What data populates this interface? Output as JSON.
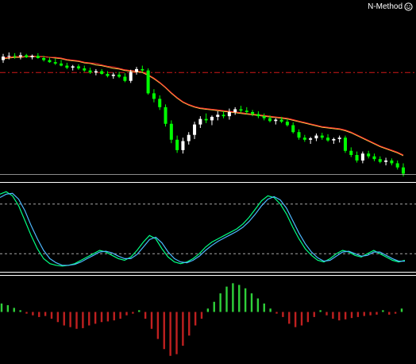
{
  "indicator_label": "N-Method",
  "icon": "smiley-icon",
  "colors": {
    "background": "#000000",
    "bull_candle": "#ffffff",
    "bear_candle": "#00ff00",
    "ma_fast": "#ffd24a",
    "ma_slow": "#ff2a2a",
    "level_line": "#d01818",
    "osc_fast": "#00ff80",
    "osc_slow": "#4db8ff",
    "hist_positive": "#2fd03a",
    "hist_negative": "#c02020",
    "separator": "#ffffff",
    "dashed_level": "#cfcfcf"
  },
  "chart_data": [
    {
      "type": "candlestick",
      "title": "",
      "series": [
        {
          "name": "",
          "kind": "ohlc",
          "values": [
            [
              100.4,
              101.3,
              100.0,
              100.9
            ],
            [
              100.9,
              101.5,
              100.5,
              101.0
            ],
            [
              101.0,
              101.4,
              100.6,
              100.9
            ],
            [
              100.9,
              101.5,
              100.5,
              101.1
            ],
            [
              101.1,
              101.3,
              100.7,
              100.8
            ],
            [
              100.8,
              101.2,
              100.5,
              101.0
            ],
            [
              101.0,
              101.4,
              100.6,
              100.7
            ],
            [
              100.7,
              101.0,
              100.2,
              100.4
            ],
            [
              100.4,
              100.8,
              100.0,
              100.1
            ],
            [
              100.1,
              100.6,
              99.7,
              99.9
            ],
            [
              99.9,
              100.4,
              99.5,
              99.6
            ],
            [
              99.6,
              100.0,
              99.1,
              99.3
            ],
            [
              99.3,
              99.7,
              98.9,
              99.5
            ],
            [
              99.5,
              99.8,
              99.0,
              99.2
            ],
            [
              99.2,
              99.6,
              98.7,
              98.9
            ],
            [
              98.9,
              99.3,
              98.4,
              98.6
            ],
            [
              98.6,
              99.1,
              98.2,
              98.8
            ],
            [
              98.8,
              99.1,
              98.3,
              98.4
            ],
            [
              98.4,
              98.8,
              97.9,
              98.1
            ],
            [
              98.1,
              98.6,
              97.7,
              98.3
            ],
            [
              98.3,
              98.7,
              97.8,
              98.0
            ],
            [
              98.0,
              98.5,
              97.2,
              97.4
            ],
            [
              97.4,
              99.0,
              97.1,
              98.7
            ],
            [
              98.7,
              99.4,
              98.3,
              99.1
            ],
            [
              99.1,
              99.6,
              98.6,
              98.9
            ],
            [
              98.9,
              99.2,
              95.4,
              95.6
            ],
            [
              95.6,
              96.2,
              94.3,
              94.8
            ],
            [
              94.8,
              95.3,
              93.2,
              93.6
            ],
            [
              93.6,
              94.0,
              90.8,
              91.2
            ],
            [
              91.2,
              91.7,
              88.4,
              88.9
            ],
            [
              88.9,
              89.5,
              87.0,
              87.4
            ],
            [
              87.4,
              89.2,
              86.9,
              88.7
            ],
            [
              88.7,
              90.0,
              88.2,
              89.6
            ],
            [
              89.6,
              91.5,
              89.0,
              91.1
            ],
            [
              91.1,
              92.3,
              90.6,
              91.9
            ],
            [
              91.9,
              92.7,
              91.3,
              91.7
            ],
            [
              91.7,
              92.4,
              91.0,
              92.2
            ],
            [
              92.2,
              93.0,
              91.7,
              92.5
            ],
            [
              92.5,
              93.0,
              92.0,
              92.3
            ],
            [
              92.3,
              93.4,
              91.8,
              92.9
            ],
            [
              92.9,
              93.6,
              92.5,
              93.3
            ],
            [
              93.3,
              93.8,
              92.8,
              93.1
            ],
            [
              93.1,
              93.6,
              92.6,
              92.9
            ],
            [
              92.9,
              93.2,
              92.3,
              92.6
            ],
            [
              92.6,
              93.0,
              92.0,
              92.3
            ],
            [
              92.3,
              92.7,
              91.7,
              92.0
            ],
            [
              92.0,
              92.4,
              91.4,
              91.6
            ],
            [
              91.6,
              92.0,
              91.1,
              91.8
            ],
            [
              91.8,
              92.2,
              91.3,
              91.5
            ],
            [
              91.5,
              91.9,
              90.8,
              91.0
            ],
            [
              91.0,
              91.4,
              89.8,
              90.0
            ],
            [
              90.0,
              90.4,
              88.9,
              89.2
            ],
            [
              89.2,
              89.6,
              88.6,
              88.9
            ],
            [
              88.9,
              89.3,
              88.3,
              89.1
            ],
            [
              89.1,
              89.8,
              88.7,
              89.5
            ],
            [
              89.5,
              89.9,
              88.9,
              89.2
            ],
            [
              89.2,
              89.7,
              88.6,
              88.8
            ],
            [
              88.8,
              89.2,
              88.3,
              89.0
            ],
            [
              89.0,
              89.5,
              88.5,
              89.2
            ],
            [
              89.2,
              89.5,
              87.0,
              87.3
            ],
            [
              87.3,
              87.8,
              86.4,
              86.7
            ],
            [
              86.7,
              87.2,
              85.6,
              85.9
            ],
            [
              85.9,
              87.2,
              85.5,
              86.9
            ],
            [
              86.9,
              87.3,
              86.2,
              86.5
            ],
            [
              86.5,
              86.9,
              85.8,
              86.1
            ],
            [
              86.1,
              86.5,
              85.5,
              85.7
            ],
            [
              85.7,
              86.3,
              85.2,
              85.9
            ],
            [
              85.9,
              86.2,
              85.2,
              85.5
            ],
            [
              85.5,
              85.9,
              84.6,
              84.9
            ],
            [
              84.9,
              85.5,
              83.6,
              84.0
            ]
          ]
        },
        {
          "name": "",
          "kind": "line",
          "color_key": "ma_fast",
          "values": [
            100.6,
            100.7,
            100.8,
            100.8,
            100.9,
            100.9,
            100.9,
            100.9,
            100.8,
            100.7,
            100.6,
            100.4,
            100.3,
            100.2,
            100.0,
            99.9,
            99.7,
            99.6,
            99.4,
            99.2,
            99.1,
            98.9,
            98.8,
            98.7,
            98.6,
            98.2,
            97.7,
            97.1,
            96.4,
            95.6,
            94.9,
            94.3,
            93.9,
            93.6,
            93.4,
            93.3,
            93.2,
            93.1,
            93.0,
            92.9,
            92.8,
            92.7,
            92.6,
            92.5,
            92.4,
            92.3,
            92.2,
            92.1,
            92.0,
            91.9,
            91.7,
            91.5,
            91.3,
            91.1,
            90.9,
            90.7,
            90.6,
            90.5,
            90.4,
            90.2,
            89.9,
            89.5,
            89.1,
            88.7,
            88.3,
            87.9,
            87.6,
            87.3,
            87.0,
            86.6
          ]
        },
        {
          "name": "",
          "kind": "line",
          "color_key": "ma_slow",
          "values": [
            100.7,
            100.8,
            100.9,
            100.9,
            100.9,
            101.0,
            100.9,
            100.9,
            100.8,
            100.8,
            100.7,
            100.5,
            100.4,
            100.3,
            100.1,
            100.0,
            99.9,
            99.7,
            99.5,
            99.4,
            99.2,
            99.0,
            98.9,
            98.8,
            98.7,
            98.3,
            97.8,
            97.2,
            96.5,
            95.7,
            95.0,
            94.4,
            94.0,
            93.7,
            93.5,
            93.4,
            93.3,
            93.2,
            93.1,
            93.0,
            92.9,
            92.8,
            92.7,
            92.6,
            92.5,
            92.4,
            92.3,
            92.2,
            92.1,
            92.0,
            91.8,
            91.6,
            91.4,
            91.2,
            91.0,
            90.8,
            90.7,
            90.6,
            90.5,
            90.3,
            90.0,
            89.6,
            89.2,
            88.8,
            88.4,
            88.0,
            87.7,
            87.4,
            87.1,
            86.7
          ]
        },
        {
          "name": "",
          "kind": "hline",
          "color_key": "level_line",
          "dashed": true,
          "value": 98.6
        }
      ]
    },
    {
      "type": "line",
      "title": "",
      "levels": [
        80,
        20
      ],
      "series": [
        {
          "name": "",
          "color_key": "osc_fast",
          "values": [
            92,
            95,
            90,
            78,
            60,
            42,
            26,
            14,
            8,
            6,
            5,
            6,
            8,
            12,
            16,
            20,
            24,
            22,
            18,
            14,
            12,
            16,
            24,
            34,
            42,
            38,
            26,
            16,
            10,
            8,
            10,
            14,
            20,
            28,
            34,
            38,
            42,
            46,
            50,
            56,
            64,
            74,
            84,
            90,
            88,
            80,
            68,
            52,
            38,
            26,
            18,
            12,
            10,
            14,
            20,
            24,
            22,
            18,
            16,
            20,
            24,
            20,
            16,
            12,
            10,
            12
          ]
        },
        {
          "name": "",
          "color_key": "osc_slow",
          "values": [
            88,
            92,
            93,
            86,
            72,
            54,
            38,
            24,
            14,
            9,
            6,
            6,
            7,
            10,
            14,
            18,
            22,
            23,
            21,
            17,
            14,
            14,
            19,
            28,
            37,
            40,
            33,
            22,
            14,
            10,
            9,
            12,
            17,
            24,
            30,
            35,
            39,
            43,
            47,
            52,
            59,
            68,
            78,
            86,
            89,
            85,
            75,
            60,
            45,
            32,
            22,
            15,
            11,
            12,
            17,
            22,
            23,
            20,
            17,
            18,
            22,
            22,
            18,
            14,
            11,
            11
          ]
        }
      ]
    },
    {
      "type": "bar",
      "title": "",
      "ylim": [
        -1.4,
        1.0
      ],
      "values": [
        0.25,
        0.2,
        0.12,
        0.05,
        -0.05,
        -0.1,
        -0.15,
        -0.12,
        -0.2,
        -0.3,
        -0.4,
        -0.45,
        -0.5,
        -0.48,
        -0.4,
        -0.35,
        -0.3,
        -0.28,
        -0.25,
        -0.2,
        -0.1,
        -0.05,
        0.05,
        -0.2,
        -0.5,
        -0.8,
        -1.1,
        -1.3,
        -1.25,
        -1.0,
        -0.7,
        -0.4,
        -0.2,
        0.1,
        0.3,
        0.55,
        0.75,
        0.85,
        0.8,
        0.7,
        0.55,
        0.4,
        0.25,
        0.1,
        -0.05,
        -0.15,
        -0.35,
        -0.45,
        -0.4,
        -0.3,
        -0.15,
        0.05,
        -0.1,
        -0.2,
        -0.25,
        -0.22,
        -0.18,
        -0.15,
        -0.12,
        -0.1,
        -0.08,
        0.05,
        -0.08,
        -0.05,
        0.1
      ]
    }
  ]
}
